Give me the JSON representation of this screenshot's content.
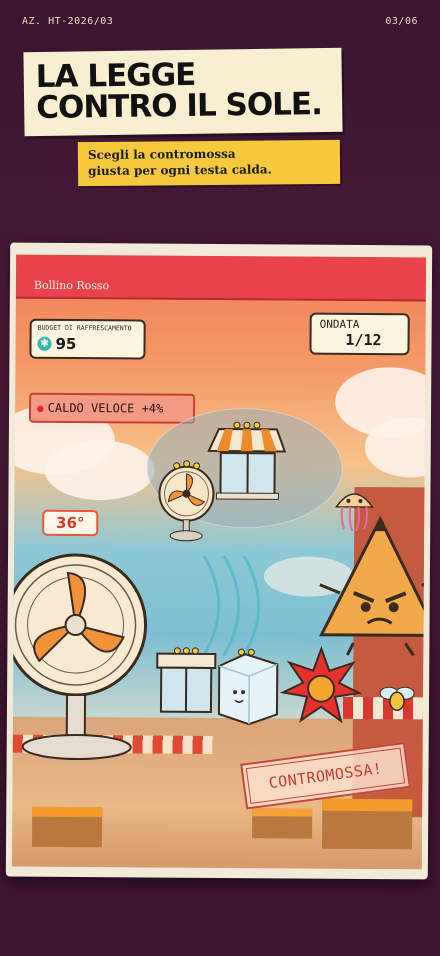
{
  "header": {
    "code": "AZ. HT-2026/03",
    "page": "03/06"
  },
  "title": {
    "line1": "LA LEGGE",
    "line2": "CONTRO IL SOLE."
  },
  "subtitle": {
    "line1": "Scegli la contromossa",
    "line2": "giusta per ogni testa calda."
  },
  "game": {
    "band_label": "Bollino Rosso",
    "budget_label": "BUDGET DI RAFFRESCAMENTO",
    "budget_value": "95",
    "wave_label": "ONDATA",
    "wave_value": "1/12",
    "modifier": "CALDO VELOCE +4%",
    "temperature": "36°",
    "stamp": "CONTROMOSSA!",
    "icons": [
      "snowflake-icon",
      "fan-icon",
      "awning-window-icon",
      "ice-cube-icon",
      "sun-burst-icon",
      "jellyfish-icon",
      "angry-triangle-icon",
      "fly-icon"
    ],
    "colors": {
      "band": "#e8434a",
      "subtitle_bg": "#f6c93c",
      "title_bg": "#f7efcf",
      "stamp": "#c63b2c"
    }
  }
}
